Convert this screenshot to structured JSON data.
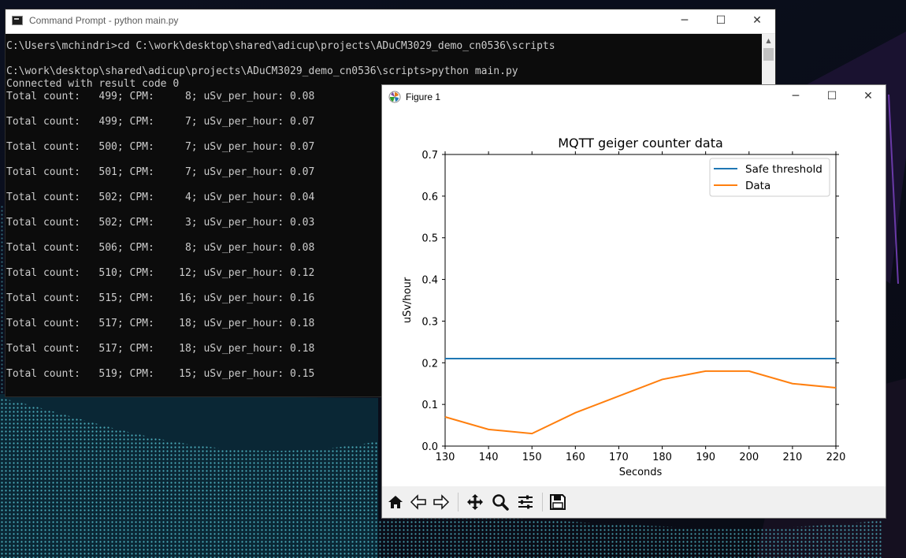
{
  "console": {
    "title": "Command Prompt - python  main.py",
    "lines": [
      "C:\\Users\\mchindri>cd C:\\work\\desktop\\shared\\adicup\\projects\\ADuCM3029_demo_cn0536\\scripts",
      "",
      "C:\\work\\desktop\\shared\\adicup\\projects\\ADuCM3029_demo_cn0536\\scripts>python main.py",
      "Connected with result code 0",
      "Total count:   499; CPM:     8; uSv_per_hour: 0.08",
      "",
      "Total count:   499; CPM:     7; uSv_per_hour: 0.07",
      "",
      "Total count:   500; CPM:     7; uSv_per_hour: 0.07",
      "",
      "Total count:   501; CPM:     7; uSv_per_hour: 0.07",
      "",
      "Total count:   502; CPM:     4; uSv_per_hour: 0.04",
      "",
      "Total count:   502; CPM:     3; uSv_per_hour: 0.03",
      "",
      "Total count:   506; CPM:     8; uSv_per_hour: 0.08",
      "",
      "Total count:   510; CPM:    12; uSv_per_hour: 0.12",
      "",
      "Total count:   515; CPM:    16; uSv_per_hour: 0.16",
      "",
      "Total count:   517; CPM:    18; uSv_per_hour: 0.18",
      "",
      "Total count:   517; CPM:    18; uSv_per_hour: 0.18",
      "",
      "Total count:   519; CPM:    15; uSv_per_hour: 0.15"
    ]
  },
  "figure": {
    "title": "Figure 1",
    "toolbar_icons": [
      "home-icon",
      "back-icon",
      "forward-icon",
      "pan-icon",
      "zoom-icon",
      "configure-subplots-icon",
      "save-icon"
    ]
  },
  "window_controls": {
    "minimize": "─",
    "maximize": "☐",
    "close": "✕"
  },
  "chart_data": {
    "type": "line",
    "title": "MQTT geiger counter data",
    "xlabel": "Seconds",
    "ylabel": "uSv/hour",
    "xlim": [
      130,
      220
    ],
    "ylim": [
      0.0,
      0.7
    ],
    "xticks": [
      130,
      140,
      150,
      160,
      170,
      180,
      190,
      200,
      210,
      220
    ],
    "yticks": [
      "0.0",
      "0.1",
      "0.2",
      "0.3",
      "0.4",
      "0.5",
      "0.6",
      "0.7"
    ],
    "grid": false,
    "legend_position": "top-right",
    "series": [
      {
        "name": "Safe threshold",
        "color": "#1f77b4",
        "x": [
          130,
          220
        ],
        "y": [
          0.21,
          0.21
        ]
      },
      {
        "name": "Data",
        "color": "#ff7f0e",
        "x": [
          130,
          140,
          150,
          160,
          170,
          180,
          190,
          200,
          210,
          220
        ],
        "y": [
          0.07,
          0.04,
          0.03,
          0.08,
          0.12,
          0.16,
          0.18,
          0.18,
          0.15,
          0.14
        ]
      }
    ]
  }
}
